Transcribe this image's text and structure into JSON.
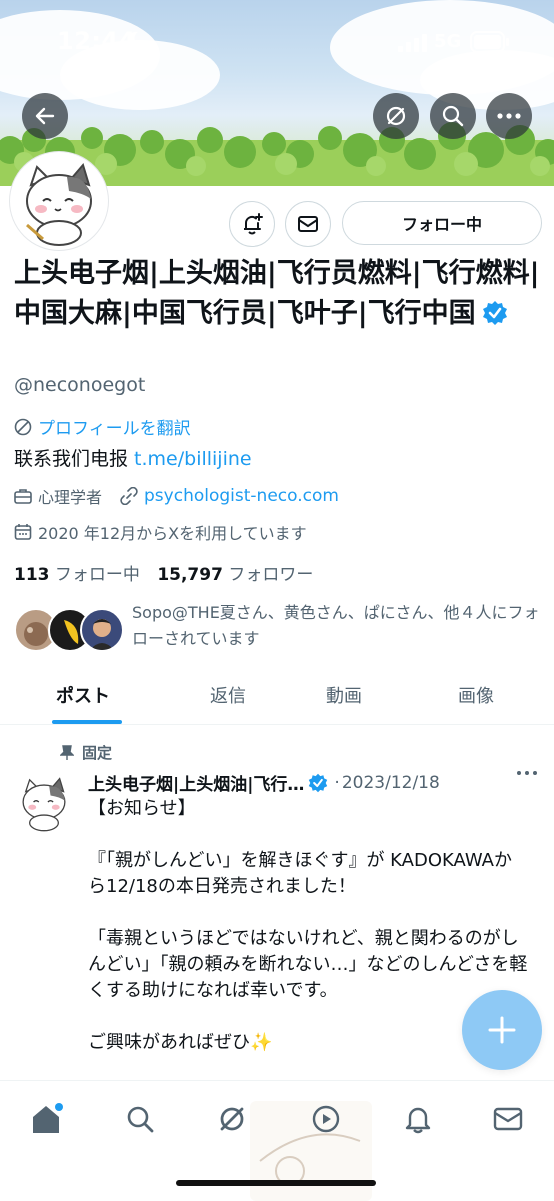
{
  "status_bar": {
    "time": "12:44",
    "network": "5G"
  },
  "profile": {
    "display_name": "上头电子烟|上头烟油|飞行员燃料|飞行燃料|中国大麻|中国飞行员|飞叶子|飞行中国",
    "handle": "@neconoegot",
    "translate_label": "プロフィールを翻訳",
    "bio_text": "联系我们电报 ",
    "bio_link": "t.me/billijine",
    "profession": "心理学者",
    "website": "psychologist-neco.com",
    "joined": "2020 年12月からXを利用しています",
    "following_count": "113",
    "following_label": "フォロー中",
    "followers_count": "15,797",
    "followers_label": "フォロワー",
    "followed_by_text": "Sopo@THE夏さん、黄色さん、ぱにさん、他４人にフォローされています",
    "follow_button_label": "フォロー中"
  },
  "tabs": [
    {
      "label": "ポスト",
      "active": true
    },
    {
      "label": "返信",
      "active": false
    },
    {
      "label": "動画",
      "active": false
    },
    {
      "label": "画像",
      "active": false
    }
  ],
  "post": {
    "pinned_label": "固定",
    "author": "上头电子烟|上头烟油|飞行…",
    "date": "2023/12/18",
    "body": "【お知らせ】\n\n『「親がしんどい」を解きほぐす』が KADOKAWAから12/18の本日発売されました！\n\n「毒親というほどではないけれど、親と関わるのがしんどい」「親の頼みを断れない…」などのしんどさを軽くする助けになれば幸いです。\n\nご興味があればぜひ✨"
  },
  "colors": {
    "accent": "#1d9bf0",
    "fab": "#8ec9f5",
    "text_secondary": "#536471"
  },
  "icons": [
    "back-arrow-icon",
    "grok-icon",
    "search-icon",
    "more-icon",
    "bell-plus-icon",
    "mail-icon",
    "verified-icon",
    "translate-icon",
    "briefcase-icon",
    "link-icon",
    "calendar-icon",
    "pin-icon",
    "plus-icon",
    "home-icon",
    "explore-icon",
    "video-icon",
    "notifications-icon",
    "messages-icon"
  ]
}
